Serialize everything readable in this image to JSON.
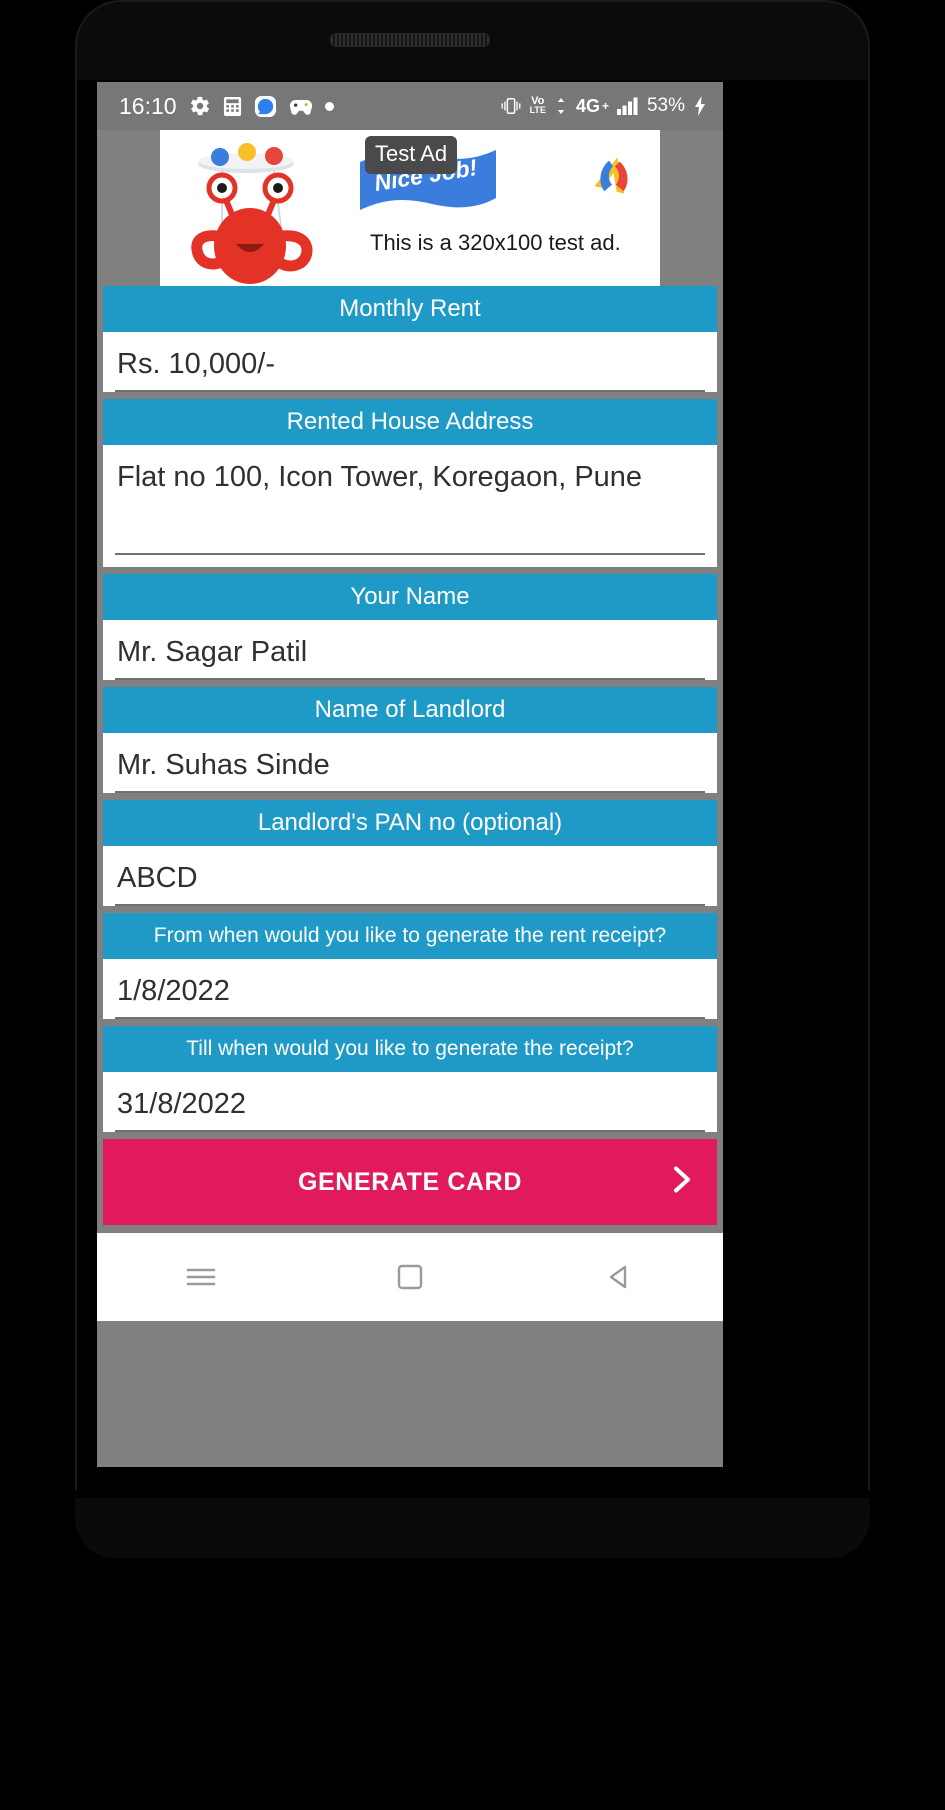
{
  "status_bar": {
    "time": "16:10",
    "icons_left": [
      "gear-icon",
      "calculator-icon",
      "messaging-icon",
      "game-controller-icon",
      "dot-icon"
    ],
    "icons_right": [
      "vibrate-icon",
      "volte-icon",
      "signal-4g-icon",
      "battery-icon"
    ],
    "volte_top": "Vo",
    "volte_bottom": "LTE",
    "network": "4G",
    "network_plus": "+",
    "battery_percent": "53%"
  },
  "ad": {
    "badge": "Test Ad",
    "ribbon_text": "Nice Job!",
    "description": "This is a 320x100 test ad.",
    "logo_name": "admob-logo"
  },
  "form": {
    "fields": [
      {
        "label": "Monthly Rent",
        "value": "Rs. 10,000/-"
      },
      {
        "label": "Rented House Address",
        "value": "Flat no 100, Icon Tower, Koregaon, Pune"
      },
      {
        "label": "Your Name",
        "value": "Mr. Sagar Patil"
      },
      {
        "label": "Name of Landlord",
        "value": "Mr. Suhas Sinde"
      },
      {
        "label": "Landlord's PAN no (optional)",
        "value": "ABCD"
      },
      {
        "label": "From when would you like to generate the rent receipt?",
        "value": "1/8/2022"
      },
      {
        "label": "Till when would you like to generate the receipt?",
        "value": "31/8/2022"
      }
    ]
  },
  "generate_button": {
    "label": "GENERATE CARD",
    "color": "#e01a5b",
    "arrow": "chevron-right-icon"
  },
  "nav_bar": {
    "menu": "menu-icon",
    "home": "home-square-icon",
    "back": "back-triangle-icon"
  },
  "colors": {
    "label_blue": "#1f9ac7",
    "background_gray": "#808080",
    "status_gray": "#777777",
    "accent_pink": "#e01a5b"
  }
}
